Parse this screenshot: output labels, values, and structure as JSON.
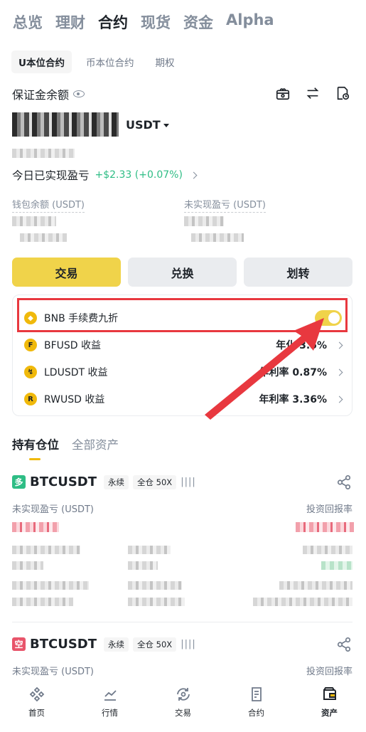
{
  "top_tabs": [
    "总览",
    "理财",
    "合约",
    "现货",
    "资金",
    "Alpha"
  ],
  "sub_tabs": [
    "U本位合约",
    "币本位合约",
    "期权"
  ],
  "margin": {
    "label": "保证金余额",
    "unit": "USDT"
  },
  "pnl_today": {
    "label": "今日已实现盈亏",
    "value": "+$2.33 (+0.07%)"
  },
  "wallet_label": "钱包余额 (USDT)",
  "unrealized_label": "未实现盈亏 (USDT)",
  "buttons": {
    "trade": "交易",
    "convert": "兑换",
    "transfer": "划转"
  },
  "earn": {
    "bnb_label": "BNB 手续费九折",
    "bnb_toggle_on": true,
    "rows": [
      {
        "coin": "BFUSD 收益",
        "rate": "年化 3.5%"
      },
      {
        "coin": "LDUSDT 收益",
        "rate": "年利率 0.87%"
      },
      {
        "coin": "RWUSD 收益",
        "rate": "年利率 3.36%"
      }
    ]
  },
  "positions_tabs": [
    "持有仓位",
    "全部资产"
  ],
  "positions": [
    {
      "side": "多",
      "symbol": "BTCUSDT",
      "type": "永续",
      "margin": "全仓 50X",
      "bars": "||||",
      "pnl_label": "未实现盈亏 (USDT)",
      "roi_label": "投资回报率"
    },
    {
      "side": "空",
      "symbol": "BTCUSDT",
      "type": "永续",
      "margin": "全仓 50X",
      "bars": "||||",
      "pnl_label": "未实现盈亏 (USDT)",
      "roi_label": "投资回报率"
    }
  ],
  "bottom_nav": [
    "首页",
    "行情",
    "交易",
    "合约",
    "资产"
  ],
  "colors": {
    "accent": "#f0d34a",
    "green": "#2ebd85",
    "red": "#e8546a",
    "highlight": "#e8383f"
  }
}
